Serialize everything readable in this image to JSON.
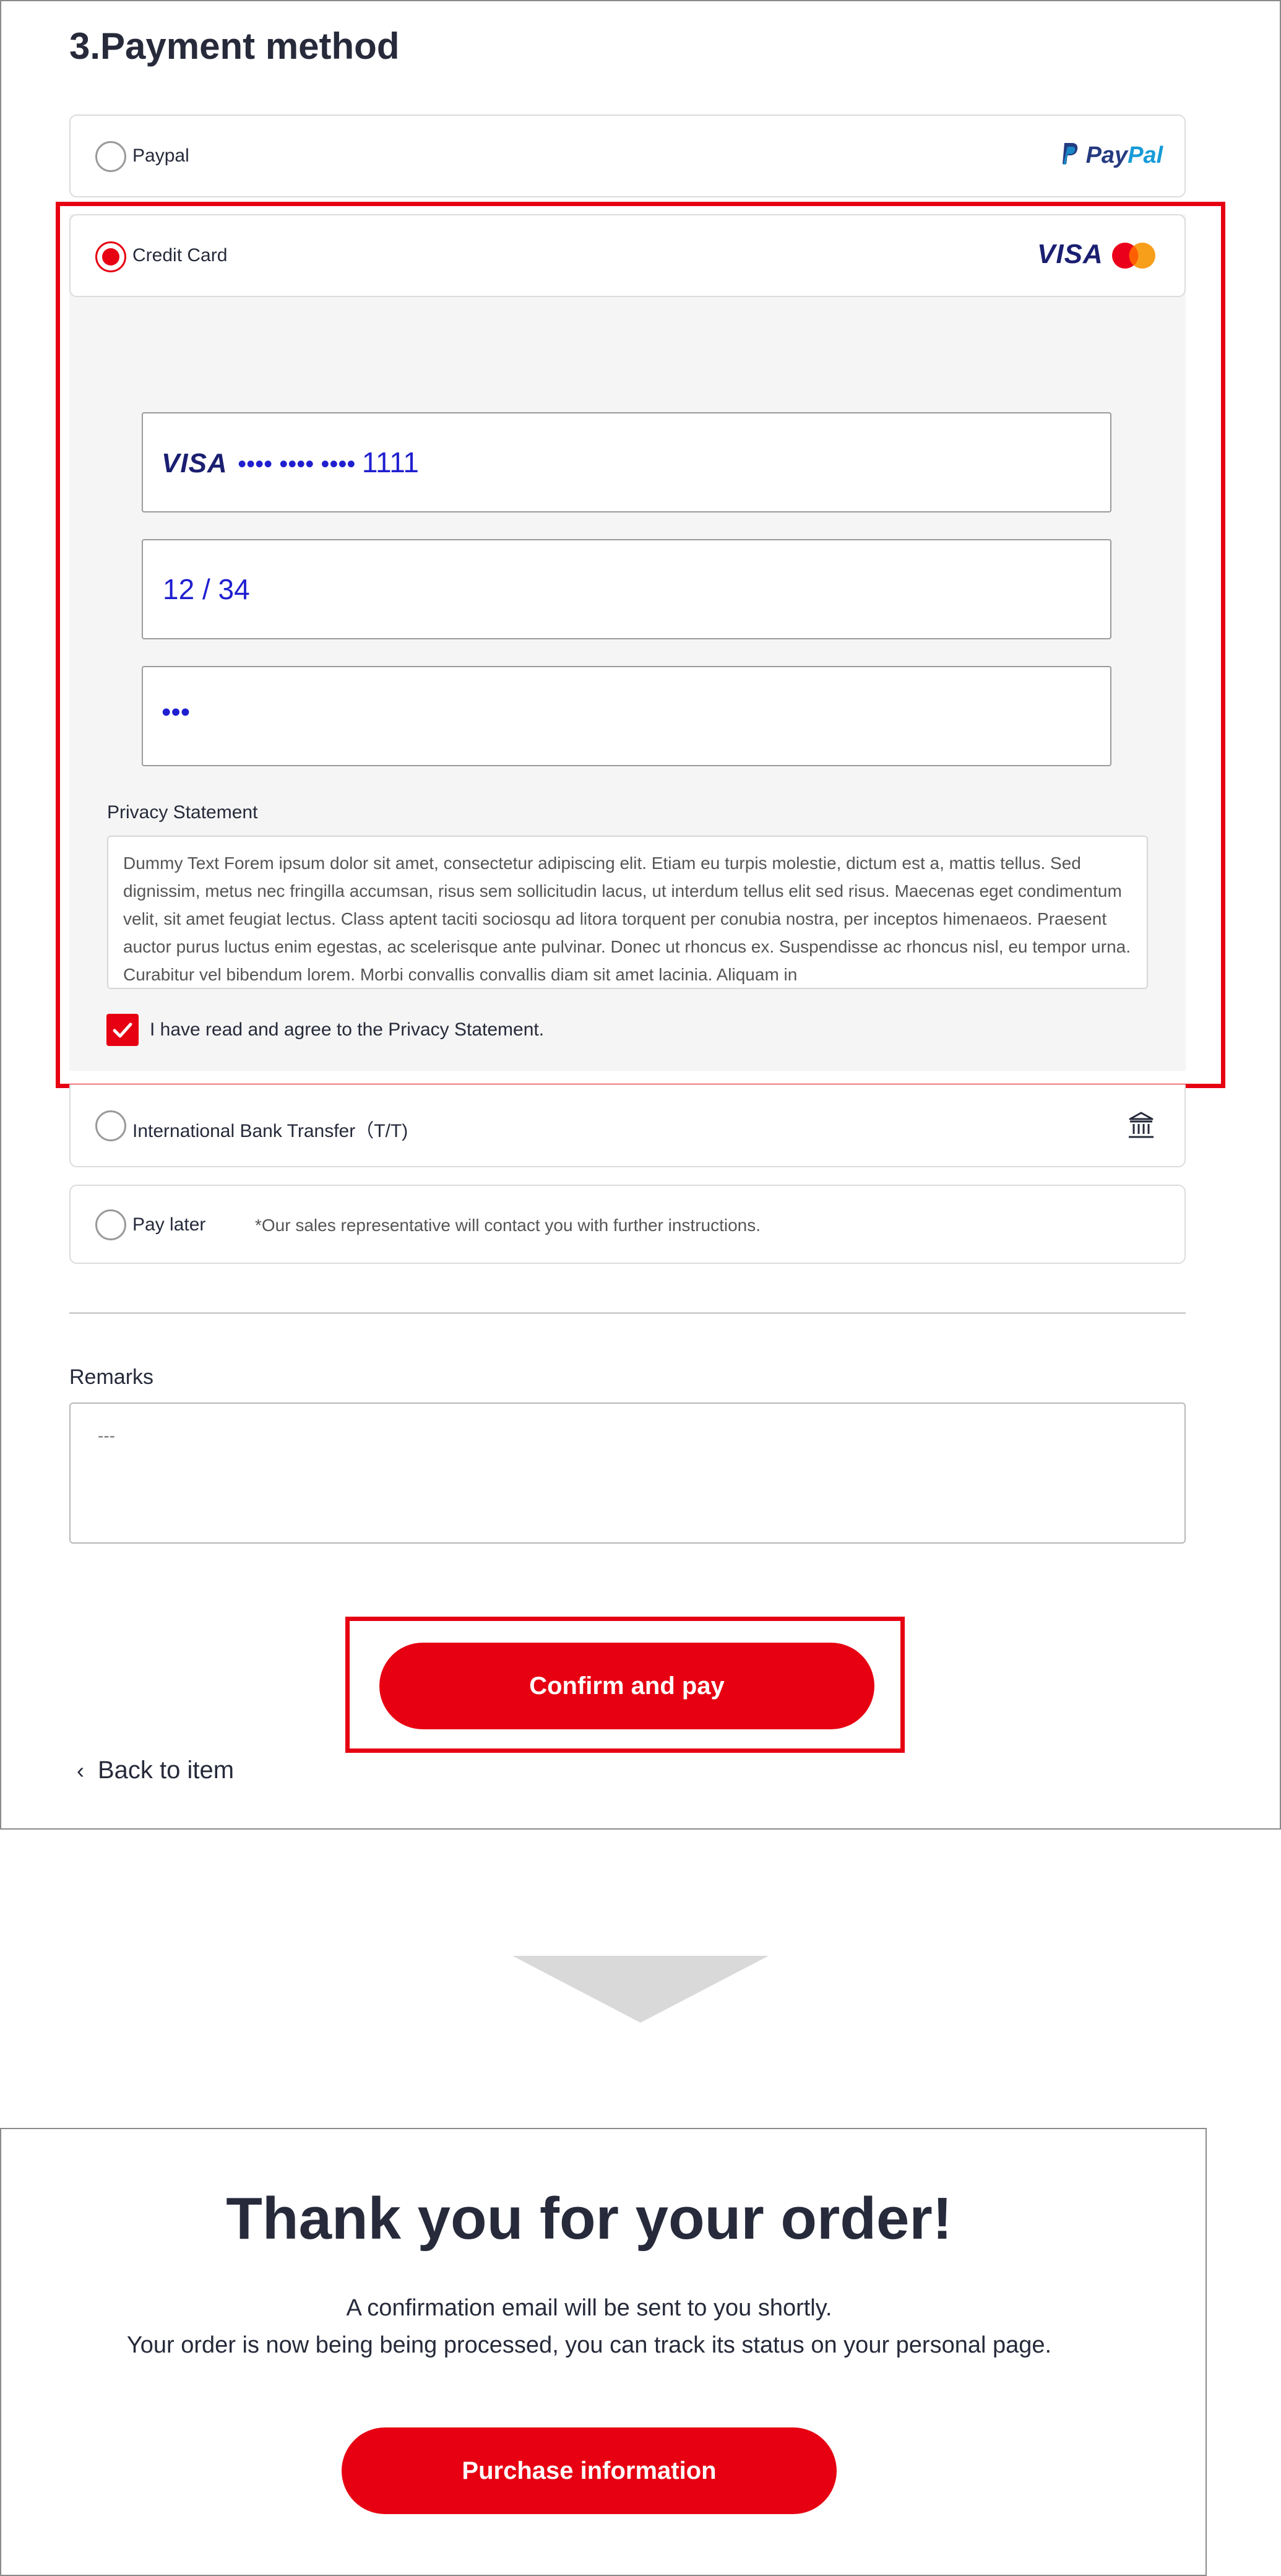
{
  "section_title": "3.Payment method",
  "options": {
    "paypal": {
      "label": "Paypal",
      "logo_main": "Pay",
      "logo_accent": "Pal"
    },
    "credit_card": {
      "label": "Credit Card",
      "visa_logo": "VISA",
      "card_number": {
        "brand": "VISA",
        "masked": "•••• •••• ••••",
        "last4": "1111"
      },
      "expiry": "12 / 34",
      "cvc": "•••",
      "privacy_title": "Privacy Statement",
      "privacy_text": "Dummy Text Forem ipsum dolor sit amet, consectetur adipiscing elit. Etiam eu turpis molestie, dictum est a, mattis tellus. Sed dignissim, metus nec fringilla accumsan, risus sem sollicitudin lacus, ut interdum tellus elit sed risus. Maecenas eget condimentum velit, sit amet feugiat lectus. Class aptent taciti sociosqu ad litora torquent per conubia nostra, per inceptos himenaeos. Praesent auctor purus luctus enim egestas, ac scelerisque ante pulvinar. Donec ut rhoncus ex. Suspendisse ac rhoncus nisl, eu tempor urna. Curabitur vel bibendum lorem. Morbi convallis convallis diam sit amet lacinia. Aliquam in",
      "agree_label": "I have read and agree to the Privacy Statement.",
      "agree_checked": true
    },
    "bank_transfer": {
      "label": "International Bank Transfer（T/T)",
      "icon": "bank-icon"
    },
    "pay_later": {
      "label": "Pay later",
      "note": "*Our sales representative will contact you with further instructions."
    }
  },
  "remarks": {
    "label": "Remarks",
    "placeholder": "---"
  },
  "confirm_button": "Confirm and pay",
  "back_link": {
    "chevron": "‹",
    "label": "Back to item"
  },
  "thankyou": {
    "title": "Thank you for your order!",
    "line1": "A confirmation email will be sent to you shortly.",
    "line2": "Your order is now being being processed, you can track its status on your personal page.",
    "button": "Purchase information"
  },
  "colors": {
    "accent": "#e60012",
    "text": "#262a3a",
    "card_text": "#1f1fd0"
  }
}
